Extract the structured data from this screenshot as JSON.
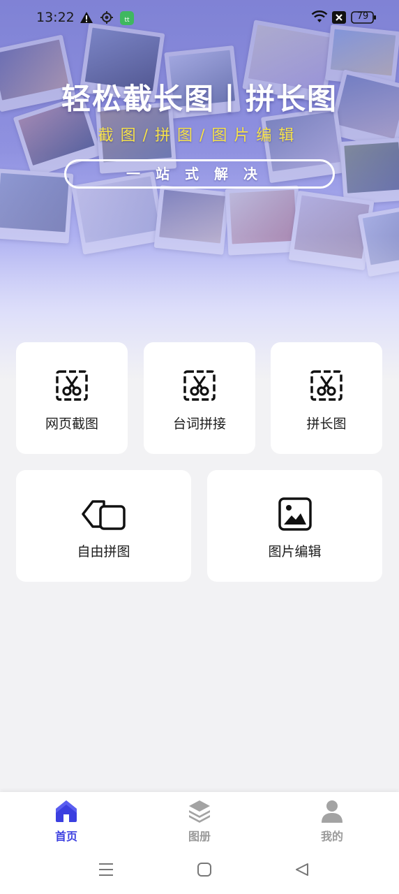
{
  "status_bar": {
    "time": "13:22",
    "battery": "79",
    "icons": [
      "warning-icon",
      "location-icon",
      "app-notification-icon",
      "wifi-icon",
      "sim-off-icon",
      "battery-icon"
    ]
  },
  "hero": {
    "title": "轻松截长图丨拼长图",
    "subtitle": "截图/拼图/图片编辑",
    "tagline": "一站式解决"
  },
  "features": [
    {
      "label": "网页截图",
      "icon": "scissors-frame-icon"
    },
    {
      "label": "台词拼接",
      "icon": "scissors-frame-icon"
    },
    {
      "label": "拼长图",
      "icon": "scissors-frame-icon"
    },
    {
      "label": "自由拼图",
      "icon": "puzzle-shapes-icon"
    },
    {
      "label": "图片编辑",
      "icon": "image-icon"
    }
  ],
  "bottom_nav": {
    "items": [
      {
        "label": "首页",
        "icon": "home-icon",
        "active": true
      },
      {
        "label": "图册",
        "icon": "layers-icon",
        "active": false
      },
      {
        "label": "我的",
        "icon": "user-icon",
        "active": false
      }
    ]
  },
  "system_nav": {
    "icons": [
      "menu-icon",
      "home-square-icon",
      "back-triangle-icon"
    ]
  },
  "colors": {
    "accent": "#3b3fe0",
    "inactive": "#9a9a9a",
    "subtitle_yellow": "#f6e24a"
  }
}
